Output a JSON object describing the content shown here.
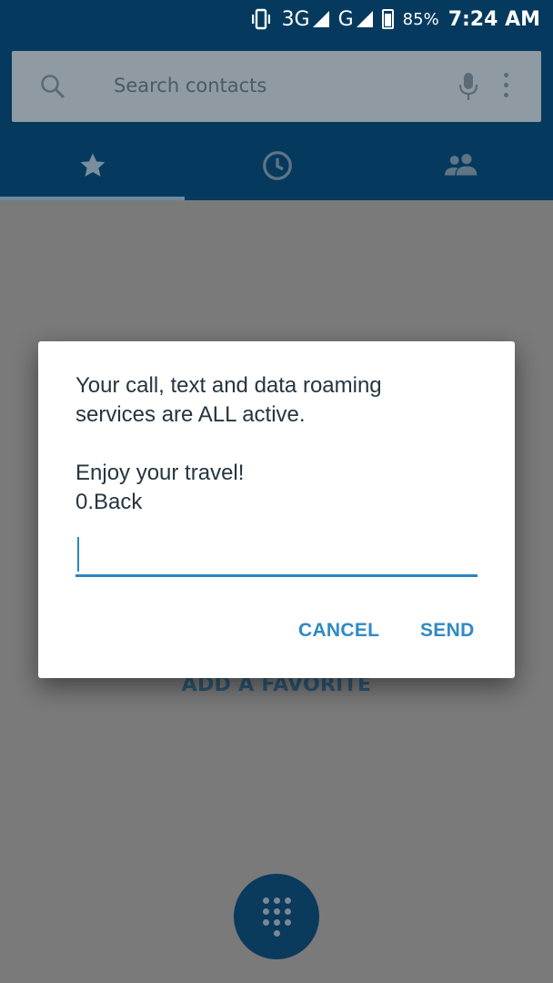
{
  "status_bar": {
    "network_1": "3G",
    "network_2": "G",
    "battery": "85%",
    "time": "7:24 AM"
  },
  "search": {
    "placeholder": "Search contacts"
  },
  "tabs": [
    {
      "icon": "star-icon"
    },
    {
      "icon": "clock-icon"
    },
    {
      "icon": "people-icon"
    }
  ],
  "content": {
    "add_favorite": "ADD A FAVORITE"
  },
  "dialog": {
    "line1": "Your call, text and data roaming",
    "line2": "services are ALL active.",
    "line3": "Enjoy your travel!",
    "line4": "0.Back",
    "input_value": "",
    "cancel_label": "CANCEL",
    "send_label": "SEND"
  },
  "colors": {
    "appbar": "#053a5e",
    "accent": "#2f8ac6"
  }
}
